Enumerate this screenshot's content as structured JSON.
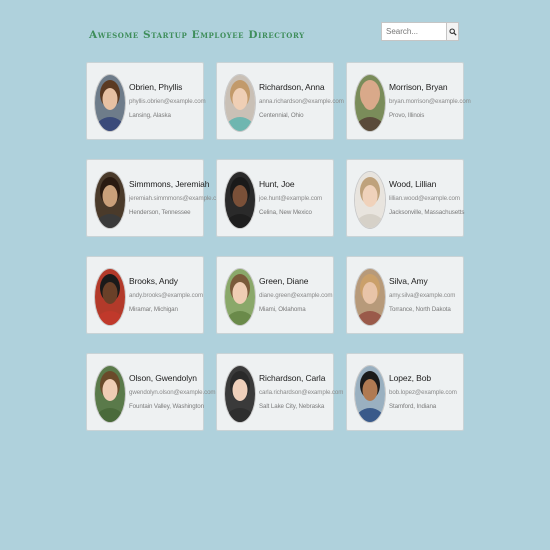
{
  "header": {
    "title": "Awesome Startup Employee Directory"
  },
  "search": {
    "placeholder": "Search...",
    "button_icon": "magnifier-icon"
  },
  "employees": [
    {
      "name": "Obrien, Phyllis",
      "email": "phyllis.obrien@example.com",
      "location": "Lansing, Alaska",
      "bg": "#6e7c8a",
      "skin": "#e7c1a3",
      "hair": "#5b3a22",
      "shirt": "#3a4a7a"
    },
    {
      "name": "Richardson, Anna",
      "email": "anna.richardson@example.com",
      "location": "Centennial, Ohio",
      "bg": "#c9c0b6",
      "skin": "#efcfb5",
      "hair": "#c29a6a",
      "shirt": "#6fb6b0"
    },
    {
      "name": "Morrison, Bryan",
      "email": "bryan.morrison@example.com",
      "location": "Provo, Illinois",
      "bg": "#7a8c5a",
      "skin": "#d9a98a",
      "hair": "#d9a98a",
      "shirt": "#5a4a3a"
    },
    {
      "name": "Simmmons, Jeremiah",
      "email": "jeremiah.simmmons@example.com",
      "location": "Henderson, Tennessee",
      "bg": "#4a3a2a",
      "skin": "#caa07a",
      "hair": "#2a1a10",
      "shirt": "#3a3a3a"
    },
    {
      "name": "Hunt, Joe",
      "email": "joe.hunt@example.com",
      "location": "Celina, New Mexico",
      "bg": "#2a2a2a",
      "skin": "#7a5038",
      "hair": "#1a1a1a",
      "shirt": "#1e1e1e"
    },
    {
      "name": "Wood, Lillian",
      "email": "lillian.wood@example.com",
      "location": "Jacksonville, Massachusetts",
      "bg": "#e8e4de",
      "skin": "#f0d2bb",
      "hair": "#bfa27c",
      "shirt": "#d6d1c8"
    },
    {
      "name": "Brooks, Andy",
      "email": "andy.brooks@example.com",
      "location": "Miramar, Michigan",
      "bg": "#b33a2a",
      "skin": "#6a4028",
      "hair": "#1a1a1a",
      "shirt": "#c0392b"
    },
    {
      "name": "Green, Diane",
      "email": "diane.green@example.com",
      "location": "Miami, Oklahoma",
      "bg": "#8aa86a",
      "skin": "#efcdb4",
      "hair": "#7a5a3a",
      "shirt": "#6a8a4a"
    },
    {
      "name": "Silva, Amy",
      "email": "amy.silva@example.com",
      "location": "Torrance, North Dakota",
      "bg": "#b79a7a",
      "skin": "#e8c4a8",
      "hair": "#caa06a",
      "shirt": "#9a5a4a"
    },
    {
      "name": "Olson, Gwendolyn",
      "email": "gwendolyn.olson@example.com",
      "location": "Fountain Valley, Washington",
      "bg": "#5a7a4a",
      "skin": "#efcdb4",
      "hair": "#6a4a2a",
      "shirt": "#4a6a3a"
    },
    {
      "name": "Richardson, Carla",
      "email": "carla.richardson@example.com",
      "location": "Salt Lake City, Nebraska",
      "bg": "#3a3a3a",
      "skin": "#efd0bb",
      "hair": "#2a2a2a",
      "shirt": "#2e2e2e"
    },
    {
      "name": "Lopez, Bob",
      "email": "bob.lopez@example.com",
      "location": "Stamford, Indiana",
      "bg": "#9ab0c0",
      "skin": "#b07a52",
      "hair": "#1a1a1a",
      "shirt": "#3a5a8a"
    }
  ]
}
